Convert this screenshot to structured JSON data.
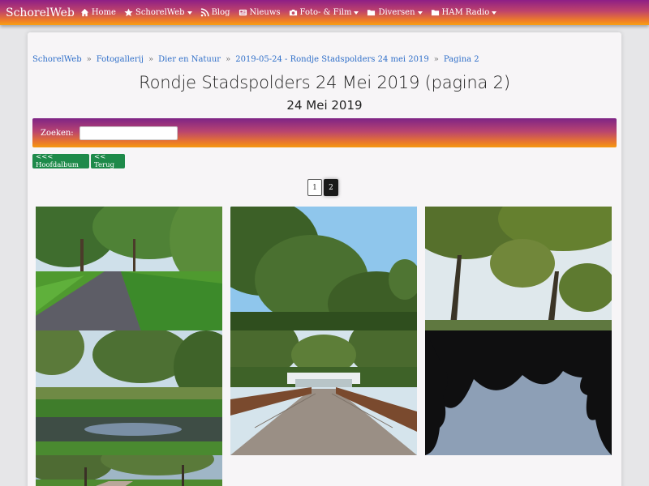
{
  "navbar": {
    "brand": "SchorelWeb",
    "items": [
      {
        "label": "Home",
        "icon": "home-icon",
        "dropdown": false
      },
      {
        "label": "SchorelWeb",
        "icon": "star-icon",
        "dropdown": true
      },
      {
        "label": "Blog",
        "icon": "rss-icon",
        "dropdown": false
      },
      {
        "label": "Nieuws",
        "icon": "newspaper-icon",
        "dropdown": false
      },
      {
        "label": "Foto- & Film",
        "icon": "camera-icon",
        "dropdown": true
      },
      {
        "label": "Diversen",
        "icon": "folder-icon",
        "dropdown": true
      },
      {
        "label": "HAM Radio",
        "icon": "folder-icon",
        "dropdown": true
      }
    ]
  },
  "breadcrumb": {
    "items": [
      "SchorelWeb",
      "Fotogallerij",
      "Dier en Natuur",
      "2019-05-24 - Rondje Stadspolders 24 mei 2019",
      "Pagina 2"
    ],
    "separator": "»"
  },
  "page": {
    "title": "Rondje Stadspolders 24 Mei 2019 (pagina 2)",
    "subtitle": "24 Mei 2019"
  },
  "search": {
    "label": "Zoeken:",
    "value": ""
  },
  "buttons": {
    "main_album": "<<< Hoofdalbum",
    "back": "<< Terug"
  },
  "pagination": {
    "pages": [
      "1",
      "2"
    ],
    "current": "2"
  },
  "gallery": {
    "photos": [
      {
        "subject": "cycle path with trees"
      },
      {
        "subject": "tree canopy against blue sky"
      },
      {
        "subject": "trees backlit sky"
      },
      {
        "subject": "pond with reeds"
      },
      {
        "subject": "wooden bridge"
      },
      {
        "subject": "dark tree silhouette"
      },
      {
        "subject": "park path"
      }
    ]
  },
  "colors": {
    "navbar_top": "#8e1f86",
    "navbar_bottom": "#f8a012",
    "link": "#2f6fc9",
    "button_green": "#1e8a4a"
  }
}
